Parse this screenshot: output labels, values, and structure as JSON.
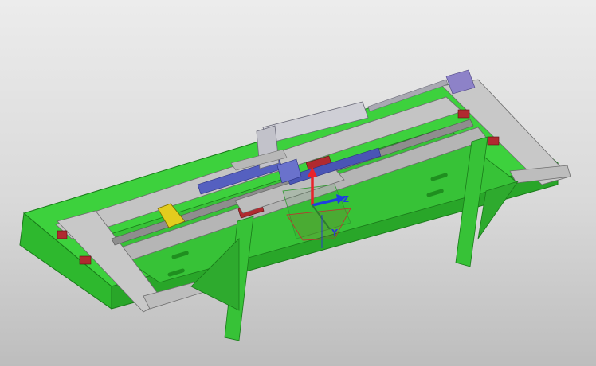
{
  "viewport": {
    "background_top": "#ececec",
    "background_bottom": "#bdbdbd"
  },
  "model": {
    "body_color": "#33cc33",
    "body_dark": "#1f9a1f",
    "frame_color": "#b0b0b0",
    "rail_color": "#9a9a9a",
    "block_color": "#b02a30",
    "rack_color": "#5560c0",
    "cylinder_color": "#c8c8d0",
    "bracket_color": "#e0c820"
  },
  "triad": {
    "z_label": "Z",
    "y_label": "Y",
    "x_color": "#e8232b",
    "y_color": "#2e7d2e",
    "z_color": "#1f3fe0"
  }
}
